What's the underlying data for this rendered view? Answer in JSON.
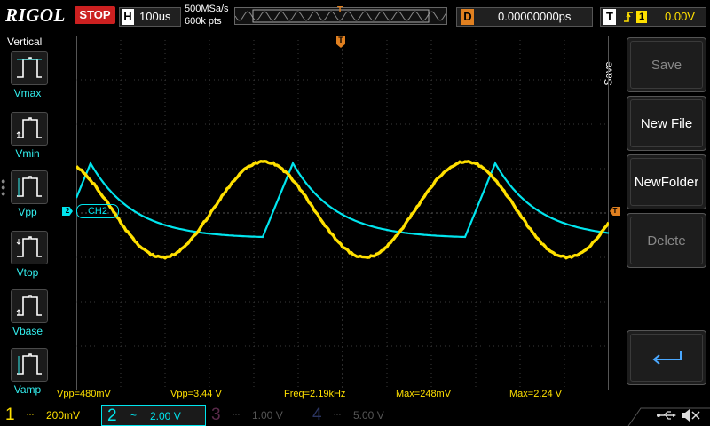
{
  "topbar": {
    "brand": "RIGOL",
    "run_state": "STOP",
    "horizontal": {
      "tag": "H",
      "value": "100us"
    },
    "sample_rate": "500MSa/s",
    "memory_depth": "600k pts",
    "trigger_pos_marker": "T",
    "delay": {
      "tag": "D",
      "value": "0.00000000ps"
    },
    "trigger": {
      "tag": "T",
      "slope_icon": "rising-edge-icon",
      "source": "1",
      "level": "0.00V"
    }
  },
  "left_panel": {
    "title": "Vertical",
    "items": [
      {
        "id": "vmax",
        "label": "Vmax",
        "icon": "vmax-icon"
      },
      {
        "id": "vmin",
        "label": "Vmin",
        "icon": "vmin-icon"
      },
      {
        "id": "vpp",
        "label": "Vpp",
        "icon": "vpp-icon"
      },
      {
        "id": "vtop",
        "label": "Vtop",
        "icon": "vtop-icon"
      },
      {
        "id": "vbase",
        "label": "Vbase",
        "icon": "vbase-icon"
      },
      {
        "id": "vamp",
        "label": "Vamp",
        "icon": "vamp-icon"
      }
    ]
  },
  "right_panel": {
    "tab": "Save",
    "buttons": [
      {
        "id": "save",
        "label": "Save",
        "enabled": false
      },
      {
        "id": "new-file",
        "label": "New File",
        "enabled": true
      },
      {
        "id": "new-folder",
        "label": "NewFolder",
        "enabled": true
      },
      {
        "id": "delete",
        "label": "Delete",
        "enabled": false
      },
      {
        "id": "back",
        "icon": "return-arrow-icon"
      }
    ]
  },
  "screen": {
    "ch2_marker": "2",
    "ch2_label": "CH2",
    "trigger_level_marker": "T",
    "trigger_pos_marker": "T"
  },
  "measurements": {
    "m1": "Vpp=480mV",
    "m2": "Vpp=3.44 V",
    "m3": "Freq=2.19kHz",
    "m4": "Max=248mV",
    "m5": "Max=2.24 V"
  },
  "channels": [
    {
      "num": "1",
      "coupling_icon": "dc-coupling-icon",
      "symbol": "⎓",
      "scale": "200mV",
      "color": "#ffe000",
      "active": true
    },
    {
      "num": "2",
      "coupling_icon": "ac-coupling-icon",
      "symbol": "~",
      "scale": "2.00 V",
      "color": "#00e5ee",
      "active": true
    },
    {
      "num": "3",
      "coupling_icon": "dc-coupling-icon",
      "symbol": "⎓",
      "scale": "1.00 V",
      "color": "#ff40c0",
      "active": false
    },
    {
      "num": "4",
      "coupling_icon": "dc-coupling-icon",
      "symbol": "⎓",
      "scale": "5.00 V",
      "color": "#4060ff",
      "active": false
    }
  ],
  "status_icons": [
    "usb-icon",
    "speaker-muted-icon"
  ],
  "colors": {
    "ch1": "#ffe000",
    "ch2": "#00e5ee",
    "trigger": "#e08020",
    "stop": "#cc2020"
  }
}
